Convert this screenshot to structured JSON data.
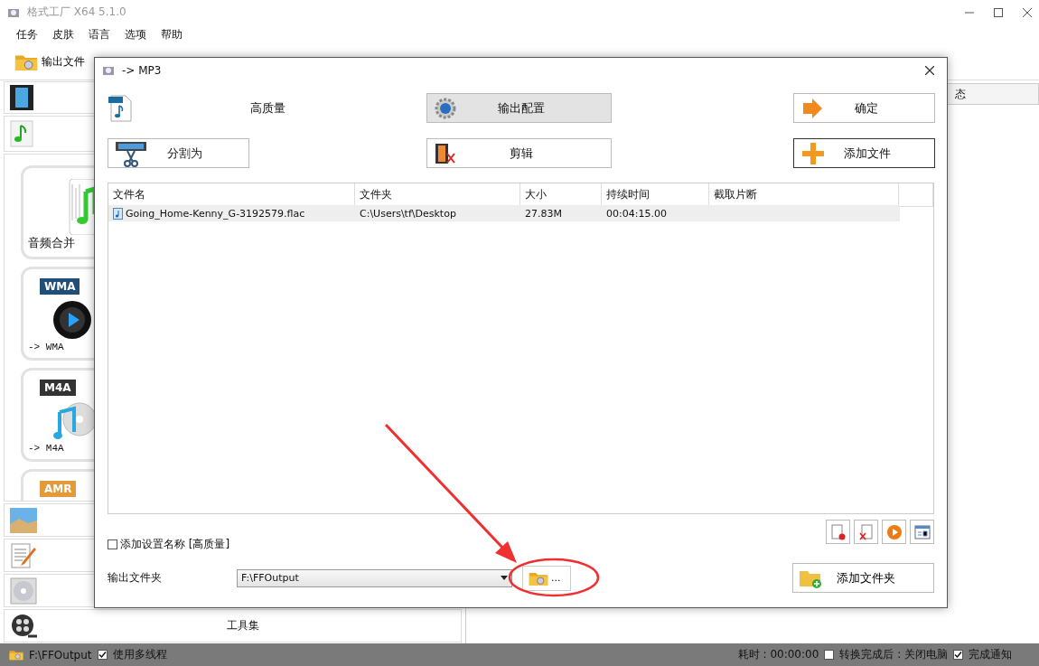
{
  "app": {
    "title": "格式工厂 X64 5.1.0"
  },
  "menu": [
    "任务",
    "皮肤",
    "语言",
    "选项",
    "帮助"
  ],
  "toolbar": {
    "output_folder": "输出文件"
  },
  "categories_top": [
    {
      "kind": "video"
    },
    {
      "kind": "audio"
    }
  ],
  "tiles": [
    {
      "kind": "merge",
      "label": "音频合并"
    },
    {
      "kind": "wma",
      "badge": "WMA",
      "label": "-> WMA"
    },
    {
      "kind": "m4a",
      "badge": "M4A",
      "label": "-> M4A"
    },
    {
      "kind": "amr",
      "badge": "AMR"
    }
  ],
  "categories_bottom": [
    {
      "kind": "picture"
    },
    {
      "kind": "document"
    },
    {
      "kind": "disc"
    },
    {
      "kind": "tools",
      "label": "工具集"
    }
  ],
  "right_panel": {
    "header": "态"
  },
  "status_bar": {
    "path": "F:\\FFOutput",
    "multithread": {
      "label": "使用多线程",
      "checked": true
    },
    "elapsed": "耗时 : 00:00:00",
    "shutdown": {
      "label": "转换完成后 : 关闭电脑",
      "checked": false
    },
    "notify": {
      "label": "完成通知",
      "checked": true
    }
  },
  "dialog": {
    "title": "-> MP3",
    "quality": "高质量",
    "buttons": [
      {
        "kind": "config",
        "label": "输出配置",
        "highlighted": true,
        "focused": false
      },
      {
        "kind": "ok",
        "label": "确定",
        "highlighted": false,
        "focused": false
      },
      {
        "kind": "split",
        "label": "分割为",
        "highlighted": false,
        "focused": false
      },
      {
        "kind": "clip",
        "label": "剪辑",
        "highlighted": false,
        "focused": false
      },
      {
        "kind": "add",
        "label": "添加文件",
        "highlighted": false,
        "focused": true
      }
    ],
    "table": {
      "columns": [
        "文件名",
        "文件夹",
        "大小",
        "持续时间",
        "截取片断"
      ],
      "rows": [
        {
          "cells": [
            "Going_Home-Kenny_G-3192579.flac",
            "C:\\Users\\tf\\Desktop",
            "27.83M",
            "00:04:15.00"
          ],
          "selected": true
        }
      ]
    },
    "file_actions": [
      {
        "kind": "remove"
      },
      {
        "kind": "clear"
      },
      {
        "kind": "play"
      },
      {
        "kind": "info"
      }
    ],
    "add_setting_name": {
      "label": "添加设置名称 [高质量]",
      "checked": false
    },
    "output_folder": {
      "label": "输出文件夹",
      "value": "F:\\FFOutput"
    },
    "browse": "...",
    "add_folder": "添加文件夹"
  },
  "annotation": {
    "arrow": true,
    "circle": true
  }
}
